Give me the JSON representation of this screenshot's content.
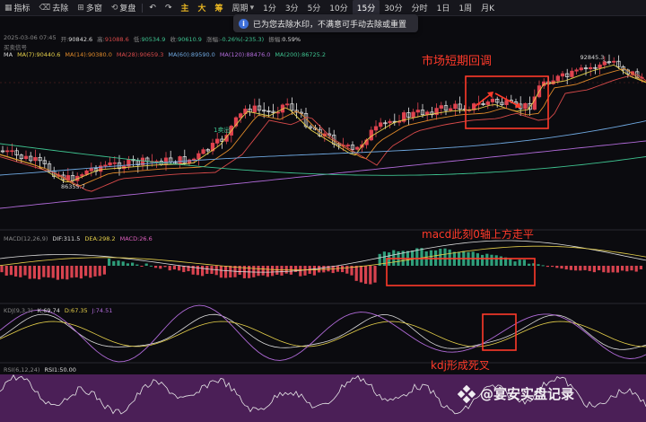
{
  "toolbar": {
    "indicator": "指标",
    "remove_label": "去除",
    "multi_window": "多窗",
    "replay": "复盘",
    "master": "主",
    "big": "大",
    "raise": "筹",
    "period": "周期",
    "periods": [
      "1分",
      "3分",
      "5分",
      "10分",
      "15分",
      "30分",
      "分时",
      "1日",
      "1周",
      "月K"
    ],
    "active_period": "15分"
  },
  "toast": {
    "text": "已为您去除水印，不满意可手动去除或重置"
  },
  "info_line": {
    "datetime": "2025-03-06 07:45",
    "open_label": "开:",
    "open": "90842.6",
    "high_label": "高:",
    "high": "91088.6",
    "low_label": "低:",
    "low": "90534.9",
    "close_label": "收:",
    "close": "90610.9",
    "change_label": "涨幅:",
    "change": "-0.26%(-235.3)",
    "amp_label": "振幅:",
    "amp": "0.59%"
  },
  "signals_label": "买卖信号",
  "ma_line": {
    "name": "MA",
    "ma7": "MA(7):90440.6",
    "ma14": "MA(14):90380.0",
    "ma28": "MA(28):90659.3",
    "ma60": "MA(60):89590.0",
    "ma120": "MA(120):88476.0",
    "ma200": "MA(200):86725.2"
  },
  "price_high_label": "92845.3",
  "price_low_label": "86355.7",
  "sell_signal": "1卖出",
  "macd_line": {
    "name": "MACD(12,26,9)",
    "dif": "DIF:311.5",
    "dea": "DEA:298.2",
    "macd": "MACD:26.6"
  },
  "kdj_line": {
    "name": "KDJ(9,3,3)",
    "k": "K:69.74",
    "d": "D:67.35",
    "j": "J:74.51"
  },
  "rsi_line": {
    "name": "RSI(6,12,24)",
    "rsi": "RSI1:50.00"
  },
  "annotations": {
    "pullback": "市场短期回调",
    "macd_flat": "macd此刻0轴上方走平",
    "kdj_cross": "kdj形成死叉"
  },
  "watermark": "@宴安实盘记录",
  "colors": {
    "up": "#e0434f",
    "down": "#e8e8e8",
    "annot": "#ff3a2a",
    "macd_pos": "#2f9e7a",
    "macd_neg": "#d8434f",
    "rsi_fill": "#4b1f57"
  }
}
